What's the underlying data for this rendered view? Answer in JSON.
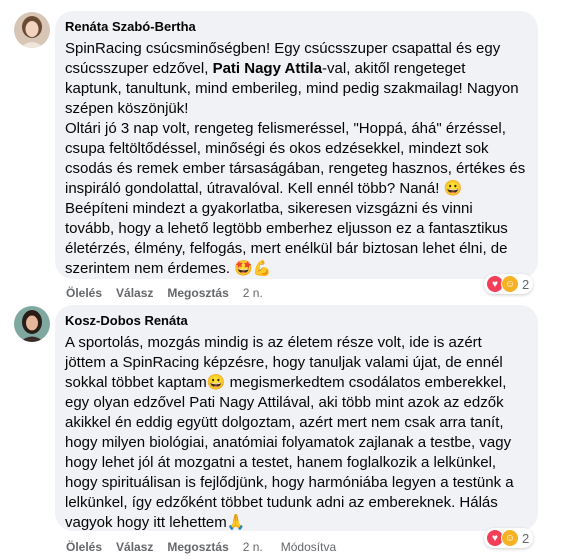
{
  "comments": [
    {
      "author": "Renáta Szabó-Bertha",
      "text_pre": "SpinRacing csúcsminőségben! Egy csúcsszuper csapattal és egy csúcsszuper edzővel, ",
      "text_bold": "Pati Nagy Attila",
      "text_post": "-val, akitől rengeteget kaptunk, tanultunk, mind emberileg, mind pedig szakmailag! Nagyon szépen köszönjük!\nOltári jó 3 nap volt, rengeteg felismeréssel, \"Hoppá, áhá\" érzéssel, csupa feltöltődéssel, minőségi és okos edzésekkel, mindezt sok csodás és remek ember társaságában, rengeteg hasznos, értékes és inspiráló gondolattal, útravalóval. Kell ennél több? Naná! 😀\nBeépíteni mindezt a gyakorlatba, sikeresen vizsgázni és vinni tovább, hogy a lehető legtöbb emberhez eljusson ez a fantasztikus életérzés, élmény, felfogás, mert enélkül bár biztosan lehet élni, de szerintem nem érdemes. 🤩💪",
      "like_label": "Ölelés",
      "reply_label": "Válasz",
      "share_label": "Megosztás",
      "time": "2 n.",
      "reaction_count": "2"
    },
    {
      "author": "Kosz-Dobos Renáta",
      "text": "A sportolás, mozgás mindig is az életem része volt, ide is azért jöttem a SpinRacing képzésre, hogy tanuljak valami újat, de ennél sokkal többet kaptam😀 megismerkedtem csodálatos emberekkel, egy olyan edzővel Pati Nagy Attilával, aki több mint azok az edzők akikkel én eddig együtt dolgoztam, azért mert nem csak arra tanít, hogy milyen biológiai, anatómiai folyamatok zajlanak a testbe, vagy hogy lehet jól át mozgatni a testet, hanem foglalkozik a lelkünkel, hogy spirituálisan is fejlődjünk, hogy harmóniába legyen a testünk a lelkünkel, így edzőként többet tudunk adni az embereknek. Hálás vagyok hogy itt lehettem🙏",
      "like_label": "Ölelés",
      "reply_label": "Válasz",
      "share_label": "Megosztás",
      "time": "2 n.",
      "edited_label": "Módosítva",
      "reaction_count": "2"
    }
  ],
  "colors": {
    "bubble": "#f0f2f5",
    "meta": "#65676b",
    "love": "#f33e58",
    "care": "#f7b125"
  }
}
